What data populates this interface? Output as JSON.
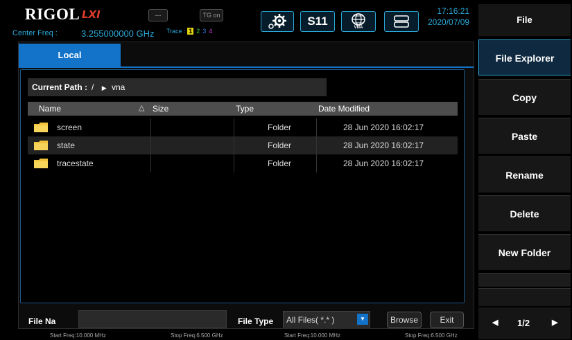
{
  "header": {
    "logo": "RIGOL",
    "logo_lxi": "LXI",
    "btn_dash": "---",
    "btn_tg": "TG on",
    "center_freq_label": "Center Freq :",
    "center_freq_value": "3.255000000 GHz",
    "trace_label": "Trace :",
    "traces": [
      "1",
      "2",
      "3",
      "4"
    ],
    "s11_label": "S11",
    "vna_label": "VNA",
    "time": "17:16:21",
    "date": "2020/07/09"
  },
  "dialog": {
    "tab_local": "Local",
    "current_path_label": "Current Path :",
    "path_root": "/",
    "path_folder": "vna",
    "columns": {
      "name": "Name",
      "size": "Size",
      "type": "Type",
      "date": "Date Modified"
    },
    "rows": [
      {
        "name": "screen",
        "size": "",
        "type": "Folder",
        "date": "28 Jun 2020 16:02:17"
      },
      {
        "name": "state",
        "size": "",
        "type": "Folder",
        "date": "28 Jun 2020 16:02:17"
      },
      {
        "name": "tracestate",
        "size": "",
        "type": "Folder",
        "date": "28 Jun 2020 16:02:17"
      }
    ],
    "file_name_label": "File Na",
    "file_name_value": "",
    "file_type_label": "File Type",
    "file_type_value": "All Files( *.* )",
    "browse_label": "Browse",
    "exit_label": "Exit"
  },
  "status": {
    "start_freq_1": "Start Freq:10.000 MHz",
    "stop_freq_1": "Stop Freq:6.500 GHz",
    "start_freq_2": "Start Freq:10.000 MHz",
    "stop_freq_2": "Stop Freq:6.500 GHz"
  },
  "menu": {
    "title": "File",
    "items": [
      "File Explorer",
      "Copy",
      "Paste",
      "Rename",
      "Delete",
      "New Folder"
    ],
    "page": "1/2"
  },
  "colors": {
    "accent_blue": "#1273c9",
    "cyan": "#2aa7d6",
    "folder_yellow": "#f2c43c",
    "logo_red": "#e13c2b"
  }
}
